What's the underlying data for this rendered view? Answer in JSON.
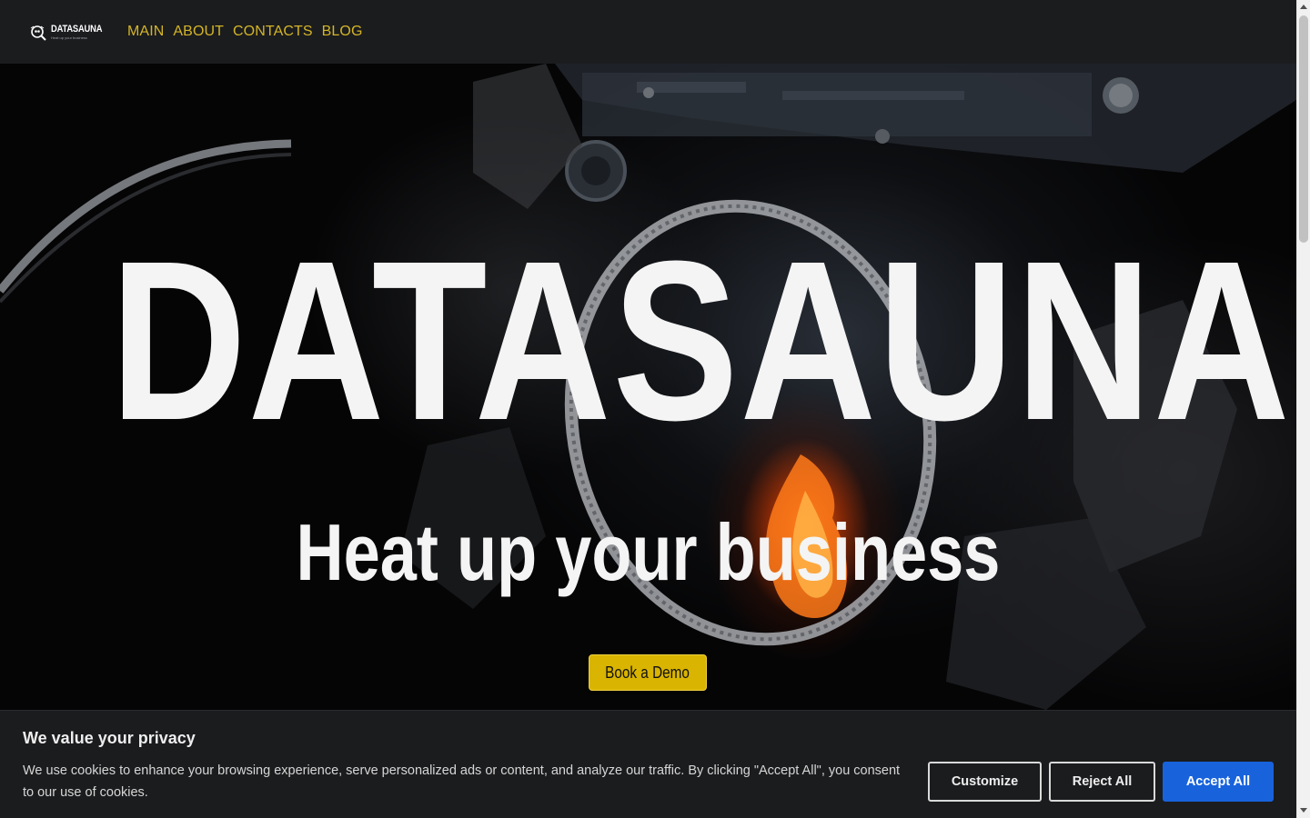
{
  "nav": {
    "logo_name": "DATASAUNA",
    "logo_tagline": "Heat up your business",
    "links": [
      "MAIN",
      "ABOUT",
      "CONTACTS",
      "BLOG"
    ],
    "link_color": "#d4b528"
  },
  "hero": {
    "title": "DATASAUNA",
    "subtitle": "Heat up your business",
    "cta_label": "Book a Demo",
    "cta_color": "#d9b400"
  },
  "cookie_banner": {
    "title": "We value your privacy",
    "text": "We use cookies to enhance your browsing experience, serve personalized ads or content, and analyze our traffic. By clicking \"Accept All\", you consent to our use of cookies.",
    "customize_label": "Customize",
    "reject_label": "Reject All",
    "accept_label": "Accept All",
    "accept_color": "#1863dc"
  }
}
